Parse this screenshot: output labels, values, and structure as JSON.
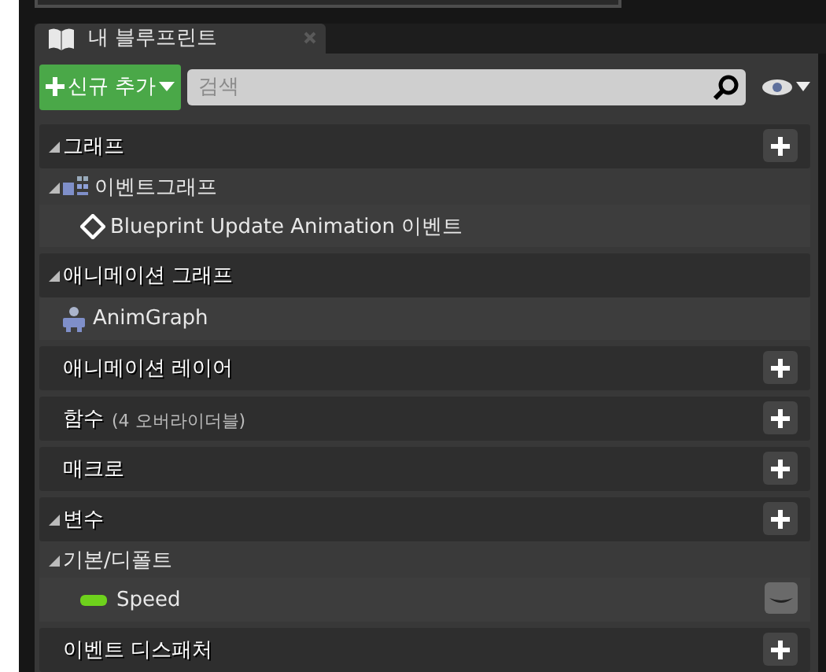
{
  "tab": {
    "label": "내 블루프린트"
  },
  "toolbar": {
    "add_button": "신규 추가",
    "search": {
      "placeholder": "검색"
    }
  },
  "rows": [
    {
      "kind": "section",
      "label": "그래프",
      "expanded": true,
      "addable": true
    },
    {
      "kind": "graph-category",
      "label": "이벤트그래프",
      "expanded": true
    },
    {
      "kind": "event",
      "label": "Blueprint Update Animation 이벤트"
    },
    {
      "kind": "section",
      "label": "애니메이션 그래프",
      "expanded": true,
      "addable": false
    },
    {
      "kind": "graph",
      "label": "AnimGraph"
    },
    {
      "kind": "section",
      "label": "애니메이션 레이어",
      "addable": true
    },
    {
      "kind": "section",
      "label": "함수",
      "note": "(4 오버라이더블)",
      "addable": true
    },
    {
      "kind": "section",
      "label": "매크로",
      "addable": true
    },
    {
      "kind": "section",
      "label": "변수",
      "expanded": true,
      "addable": true
    },
    {
      "kind": "category",
      "label": "기본/디폴트",
      "expanded": true
    },
    {
      "kind": "variable",
      "label": "Speed",
      "color": "#6ed21c"
    },
    {
      "kind": "section",
      "label": "이벤트 디스패처",
      "addable": true
    }
  ]
}
